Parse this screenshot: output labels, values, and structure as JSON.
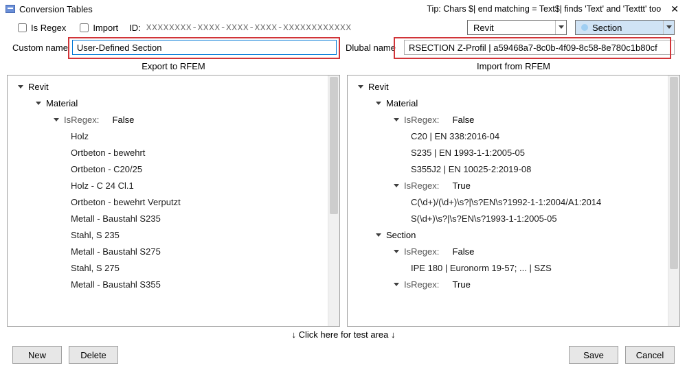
{
  "title": "Conversion Tables",
  "tip": "Tip: Chars $| end matching = Text$| finds 'Text' and 'Texttt' too",
  "checkbox_isregex": "Is Regex",
  "checkbox_import": "Import",
  "id_label": "ID:",
  "id_value": "XXXXXXXX-XXXX-XXXX-XXXX-XXXXXXXXXXXX",
  "dropdown_app": "Revit",
  "dropdown_type": "Section",
  "custom_name_label": "Custom name",
  "custom_name_value": "User-Defined Section",
  "dlubal_name_label": "Dlubal name",
  "dlubal_name_value": "RSECTION Z-Profil | a59468a7-8c0b-4f09-8c58-8e780c1b80cf",
  "export_title": "Export to RFEM",
  "import_title": "Import from RFEM",
  "export_tree": {
    "root": "Revit",
    "material": "Material",
    "regex_label": "IsRegex:",
    "regex_false": "False",
    "items": [
      "Holz",
      "Ortbeton - bewehrt",
      "Ortbeton - C20/25",
      "Holz - C 24 Cl.1",
      "Ortbeton - bewehrt Verputzt",
      "Metall - Baustahl S235",
      "Stahl, S 235",
      "Metall - Baustahl S275",
      "Stahl, S 275",
      "Metall - Baustahl S355"
    ]
  },
  "import_tree": {
    "root": "Revit",
    "material": "Material",
    "section": "Section",
    "regex_label": "IsRegex:",
    "regex_false": "False",
    "regex_true": "True",
    "mat_false_items": [
      "C20 | EN 338:2016-04",
      "S235 | EN 1993-1-1:2005-05",
      "S355J2 | EN 10025-2:2019-08"
    ],
    "mat_true_items": [
      "C(\\d+)/(\\d+)\\s?|\\s?EN\\s?1992-1-1:2004/A1:2014",
      "S(\\d+)\\s?|\\s?EN\\s?1993-1-1:2005-05"
    ],
    "sec_false_items": [
      "IPE 180 | Euronorm 19-57; ... | SZS"
    ]
  },
  "test_area": "↓ Click here for test area ↓",
  "buttons": {
    "new": "New",
    "delete": "Delete",
    "save": "Save",
    "cancel": "Cancel"
  }
}
